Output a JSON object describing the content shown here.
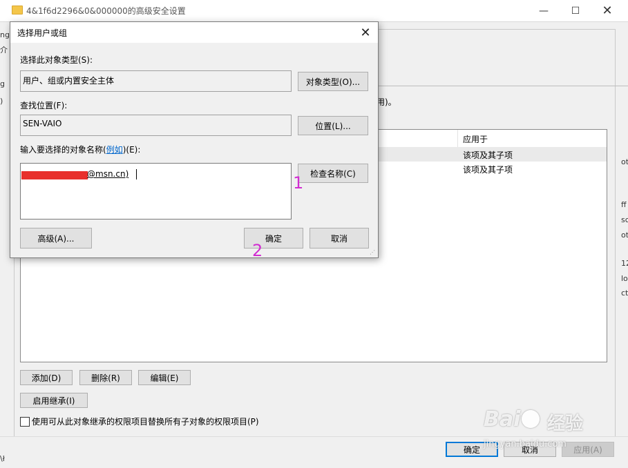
{
  "bg_window": {
    "title": "4&1f6d2296&0&000000的高级安全设置",
    "min_glyph": "—",
    "max_glyph": "☐",
    "close_glyph": "✕",
    "info_tail": "用)。",
    "table": {
      "col_applies": "应用于",
      "rows": [
        {
          "applies": "该项及其子项"
        },
        {
          "applies": "该项及其子项"
        }
      ]
    },
    "add_label": "添加(D)",
    "remove_label": "删除(R)",
    "edit_label": "编辑(E)",
    "inherit_label": "启用继承(I)",
    "replace_checkbox_label": "使用可从此对象继承的权限项目替换所有子对象的权限项目(P)",
    "replace_checked": false,
    "ok_label": "确定",
    "cancel_label": "取消",
    "apply_label": "应用(A)",
    "edge_fragments": [
      "介",
      "ng",
      "g",
      ")",
      "ot",
      "ff",
      "sc",
      "ot",
      "12",
      "lo",
      "ct",
      "\\ł"
    ]
  },
  "dialog": {
    "title": "选择用户或组",
    "close_glyph": "✕",
    "object_type_label": "选择此对象类型(S):",
    "object_type_value": "用户、组或内置安全主体",
    "object_type_button": "对象类型(O)...",
    "location_label": "查找位置(F):",
    "location_value": "SEN-VAIO",
    "location_button": "位置(L)...",
    "enter_label_prefix": "输入要选择的对象名称(",
    "enter_label_link": "例如",
    "enter_label_suffix": ")(E):",
    "name_value": "@msn.cn)",
    "check_names_button": "检查名称(C)",
    "advanced_button": "高级(A)...",
    "ok_button": "确定",
    "cancel_button": "取消"
  },
  "annotations": {
    "step1": "1",
    "step2": "2",
    "color": "#d12ed1"
  },
  "watermark": {
    "logo": "Bai",
    "logo2": "经验",
    "url": "jingyan.baidu.com"
  }
}
